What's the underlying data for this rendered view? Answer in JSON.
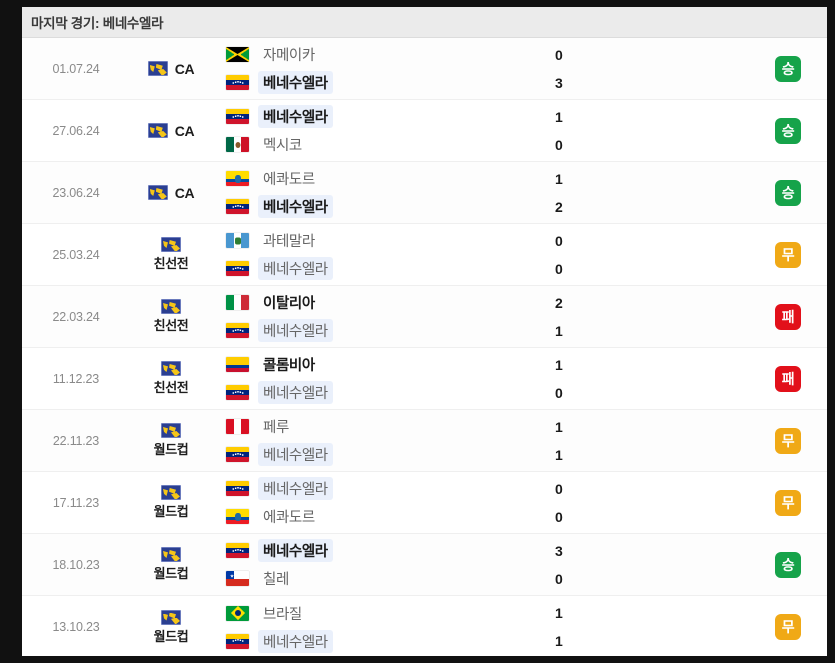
{
  "header": {
    "title": "마지막 경기: 베네수엘라"
  },
  "highlight_team": "베네수엘라",
  "matches": [
    {
      "date": "01.07.24",
      "competition": {
        "label": "CA",
        "layout": "inline",
        "icon": "world-map-icon"
      },
      "home": {
        "name": "자메이카",
        "flag": "jamaica",
        "bold": false,
        "highlight": false,
        "score": "0"
      },
      "away": {
        "name": "베네수엘라",
        "flag": "venezuela",
        "bold": true,
        "highlight": true,
        "score": "3"
      },
      "result": {
        "label": "승",
        "type": "win",
        "color": "#16a34a"
      }
    },
    {
      "date": "27.06.24",
      "competition": {
        "label": "CA",
        "layout": "inline",
        "icon": "world-map-icon"
      },
      "home": {
        "name": "베네수엘라",
        "flag": "venezuela",
        "bold": true,
        "highlight": true,
        "score": "1"
      },
      "away": {
        "name": "멕시코",
        "flag": "mexico",
        "bold": false,
        "highlight": false,
        "score": "0"
      },
      "result": {
        "label": "승",
        "type": "win",
        "color": "#16a34a"
      }
    },
    {
      "date": "23.06.24",
      "competition": {
        "label": "CA",
        "layout": "inline",
        "icon": "world-map-icon"
      },
      "home": {
        "name": "에콰도르",
        "flag": "ecuador",
        "bold": false,
        "highlight": false,
        "score": "1"
      },
      "away": {
        "name": "베네수엘라",
        "flag": "venezuela",
        "bold": true,
        "highlight": true,
        "score": "2"
      },
      "result": {
        "label": "승",
        "type": "win",
        "color": "#16a34a"
      }
    },
    {
      "date": "25.03.24",
      "competition": {
        "label": "친선전",
        "layout": "stacked",
        "icon": "world-map-icon"
      },
      "home": {
        "name": "과테말라",
        "flag": "guatemala",
        "bold": false,
        "highlight": false,
        "score": "0"
      },
      "away": {
        "name": "베네수엘라",
        "flag": "venezuela",
        "bold": false,
        "highlight": true,
        "score": "0"
      },
      "result": {
        "label": "무",
        "type": "draw",
        "color": "#f0a916"
      }
    },
    {
      "date": "22.03.24",
      "competition": {
        "label": "친선전",
        "layout": "stacked",
        "icon": "world-map-icon"
      },
      "home": {
        "name": "이탈리아",
        "flag": "italy",
        "bold": true,
        "highlight": false,
        "score": "2"
      },
      "away": {
        "name": "베네수엘라",
        "flag": "venezuela",
        "bold": false,
        "highlight": true,
        "score": "1"
      },
      "result": {
        "label": "패",
        "type": "loss",
        "color": "#e2101a"
      }
    },
    {
      "date": "11.12.23",
      "competition": {
        "label": "친선전",
        "layout": "stacked",
        "icon": "world-map-icon"
      },
      "home": {
        "name": "콜롬비아",
        "flag": "colombia",
        "bold": true,
        "highlight": false,
        "score": "1"
      },
      "away": {
        "name": "베네수엘라",
        "flag": "venezuela",
        "bold": false,
        "highlight": true,
        "score": "0"
      },
      "result": {
        "label": "패",
        "type": "loss",
        "color": "#e2101a"
      }
    },
    {
      "date": "22.11.23",
      "competition": {
        "label": "월드컵",
        "layout": "stacked",
        "icon": "world-map-icon"
      },
      "home": {
        "name": "페루",
        "flag": "peru",
        "bold": false,
        "highlight": false,
        "score": "1"
      },
      "away": {
        "name": "베네수엘라",
        "flag": "venezuela",
        "bold": false,
        "highlight": true,
        "score": "1"
      },
      "result": {
        "label": "무",
        "type": "draw",
        "color": "#f0a916"
      }
    },
    {
      "date": "17.11.23",
      "competition": {
        "label": "월드컵",
        "layout": "stacked",
        "icon": "world-map-icon"
      },
      "home": {
        "name": "베네수엘라",
        "flag": "venezuela",
        "bold": false,
        "highlight": true,
        "score": "0"
      },
      "away": {
        "name": "에콰도르",
        "flag": "ecuador",
        "bold": false,
        "highlight": false,
        "score": "0"
      },
      "result": {
        "label": "무",
        "type": "draw",
        "color": "#f0a916"
      }
    },
    {
      "date": "18.10.23",
      "competition": {
        "label": "월드컵",
        "layout": "stacked",
        "icon": "world-map-icon"
      },
      "home": {
        "name": "베네수엘라",
        "flag": "venezuela",
        "bold": true,
        "highlight": true,
        "score": "3"
      },
      "away": {
        "name": "칠레",
        "flag": "chile",
        "bold": false,
        "highlight": false,
        "score": "0"
      },
      "result": {
        "label": "승",
        "type": "win",
        "color": "#16a34a"
      }
    },
    {
      "date": "13.10.23",
      "competition": {
        "label": "월드컵",
        "layout": "stacked",
        "icon": "world-map-icon"
      },
      "home": {
        "name": "브라질",
        "flag": "brazil",
        "bold": false,
        "highlight": false,
        "score": "1"
      },
      "away": {
        "name": "베네수엘라",
        "flag": "venezuela",
        "bold": false,
        "highlight": true,
        "score": "1"
      },
      "result": {
        "label": "무",
        "type": "draw",
        "color": "#f0a916"
      }
    }
  ]
}
